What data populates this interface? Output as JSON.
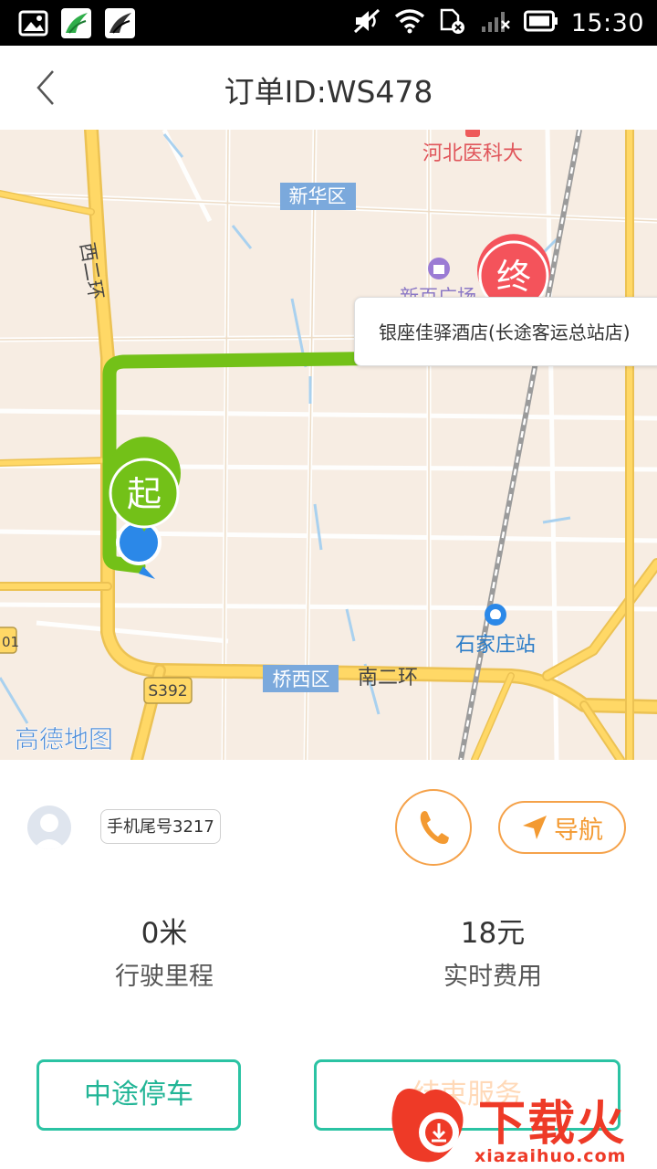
{
  "status_bar": {
    "time": "15:30"
  },
  "header": {
    "title": "订单ID:WS478"
  },
  "map": {
    "destination_name": "银座佳驿酒店(长途客运总站店)",
    "start_marker": "起",
    "end_marker": "终",
    "labels": {
      "hebei_medical": "河北医科大",
      "xinhua_district": "新华区",
      "xibaiguang": "新百广场",
      "west_second_ring": "西二环",
      "shijiazhuang_station": "石家庄站",
      "qiaoxi_district": "桥西区",
      "south_second_ring": "南二环",
      "s392": "S392",
      "left_edge_shield": "01",
      "amap_logo": "高德地图"
    }
  },
  "passenger": {
    "phone_tail": "手机尾号3217"
  },
  "actions": {
    "navigate_label": "导航"
  },
  "stats": {
    "distance_value": "0米",
    "distance_label": "行驶里程",
    "fee_value": "18元",
    "fee_label": "实时费用"
  },
  "buttons": {
    "midway_stop": "中途停车",
    "end_service": "结束服务"
  },
  "watermark": {
    "brand": "下载火",
    "domain": "xiazaihuo.com"
  },
  "colors": {
    "route_green": "#73c118",
    "accent_orange": "#f5a24a",
    "teal": "#2bc3a3",
    "end_red": "#f4535b"
  }
}
